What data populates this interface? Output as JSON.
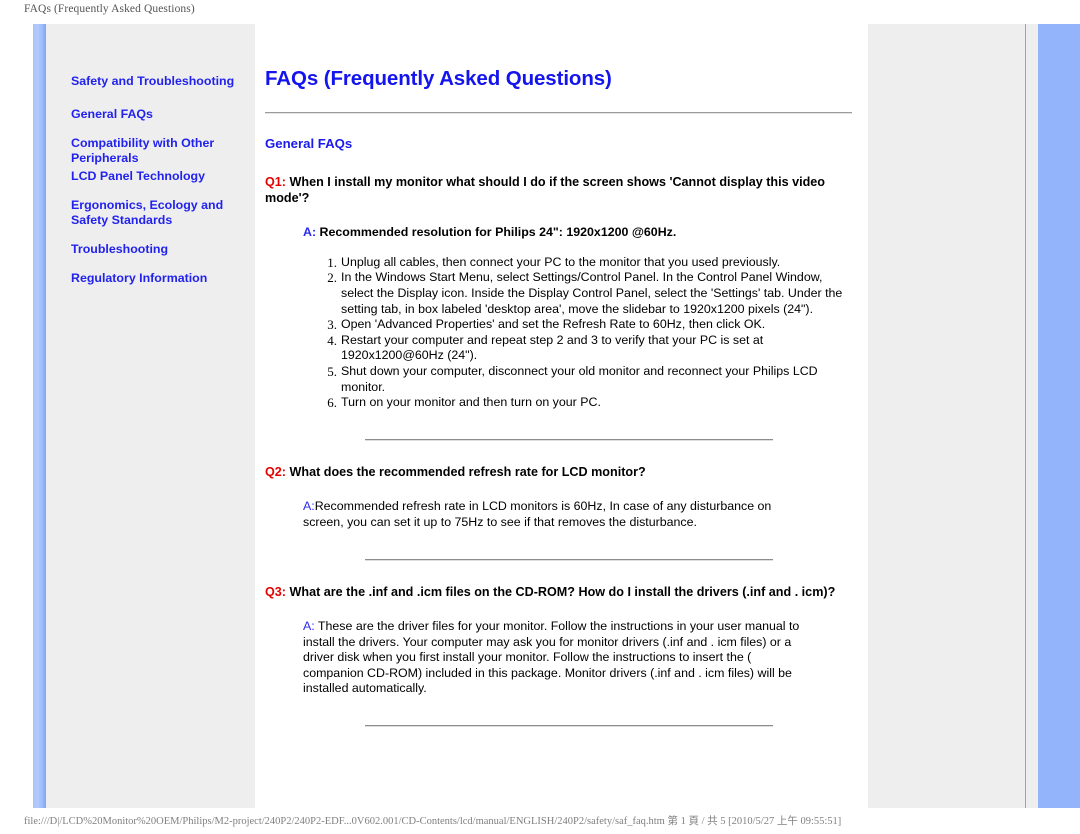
{
  "print": {
    "header": "FAQs (Frequently Asked Questions)",
    "footer": "file:///D|/LCD%20Monitor%20OEM/Philips/M2-project/240P2/240P2-EDF...0V602.001/CD-Contents/lcd/manual/ENGLISH/240P2/safety/saf_faq.htm 第 1 頁 / 共 5 [2010/5/27 上午 09:55:51]"
  },
  "colors": {
    "link": "#2222ee",
    "title": "#1414ee",
    "question_tag": "#e60000",
    "answer_tag": "#2a2aef",
    "panel_bg": "#eeeeee",
    "accent_bar": "#93b4fb"
  },
  "sidebar": {
    "items": [
      {
        "label": "Safety and Troubleshooting"
      },
      {
        "label": "General FAQs"
      },
      {
        "label": "Compatibility with Other Peripherals"
      },
      {
        "label": "LCD Panel Technology"
      },
      {
        "label": "Ergonomics, Ecology and Safety Standards"
      },
      {
        "label": "Troubleshooting"
      },
      {
        "label": "Regulatory Information"
      }
    ]
  },
  "main": {
    "title": "FAQs (Frequently Asked Questions)",
    "section_title": "General FAQs",
    "q1": {
      "tag": "Q1:",
      "text": " When I install my monitor what should I do if the screen shows 'Cannot display this video mode'?",
      "answer_tag": "A:",
      "answer_text": " Recommended resolution for Philips 24\": 1920x1200 @60Hz.",
      "steps": [
        "Unplug all cables, then connect your PC to the monitor that you used previously.",
        "In the Windows Start Menu, select Settings/Control Panel. In the Control Panel Window, select the Display icon. Inside the Display Control Panel, select the 'Settings' tab. Under the setting tab, in box labeled 'desktop area', move the slidebar to 1920x1200 pixels (24\").",
        "Open 'Advanced Properties' and set the Refresh Rate to 60Hz, then click OK.",
        "Restart your computer and repeat step 2 and 3 to verify that your PC is set at 1920x1200@60Hz (24\").",
        "Shut down your computer, disconnect your old monitor and reconnect your Philips LCD monitor.",
        "Turn on your monitor and then turn on your PC."
      ]
    },
    "q2": {
      "tag": "Q2:",
      "text": " What does the recommended refresh rate for LCD monitor?",
      "answer_tag": "A:",
      "answer_text": "Recommended refresh rate in LCD monitors is 60Hz, In case of any disturbance on screen, you can set it up to 75Hz to see if that removes the disturbance."
    },
    "q3": {
      "tag": "Q3:",
      "text": " What are the .inf and .icm files on the CD-ROM? How do I install the drivers (.inf and . icm)?",
      "answer_tag": "A:",
      "answer_text": " These are the driver files for your monitor. Follow the instructions in your user manual to install the drivers. Your computer may ask you for monitor drivers (.inf and . icm files) or a driver disk when you first install your monitor. Follow the instructions to insert the ( companion CD-ROM) included in this package. Monitor drivers (.inf and . icm files) will be installed automatically."
    }
  }
}
